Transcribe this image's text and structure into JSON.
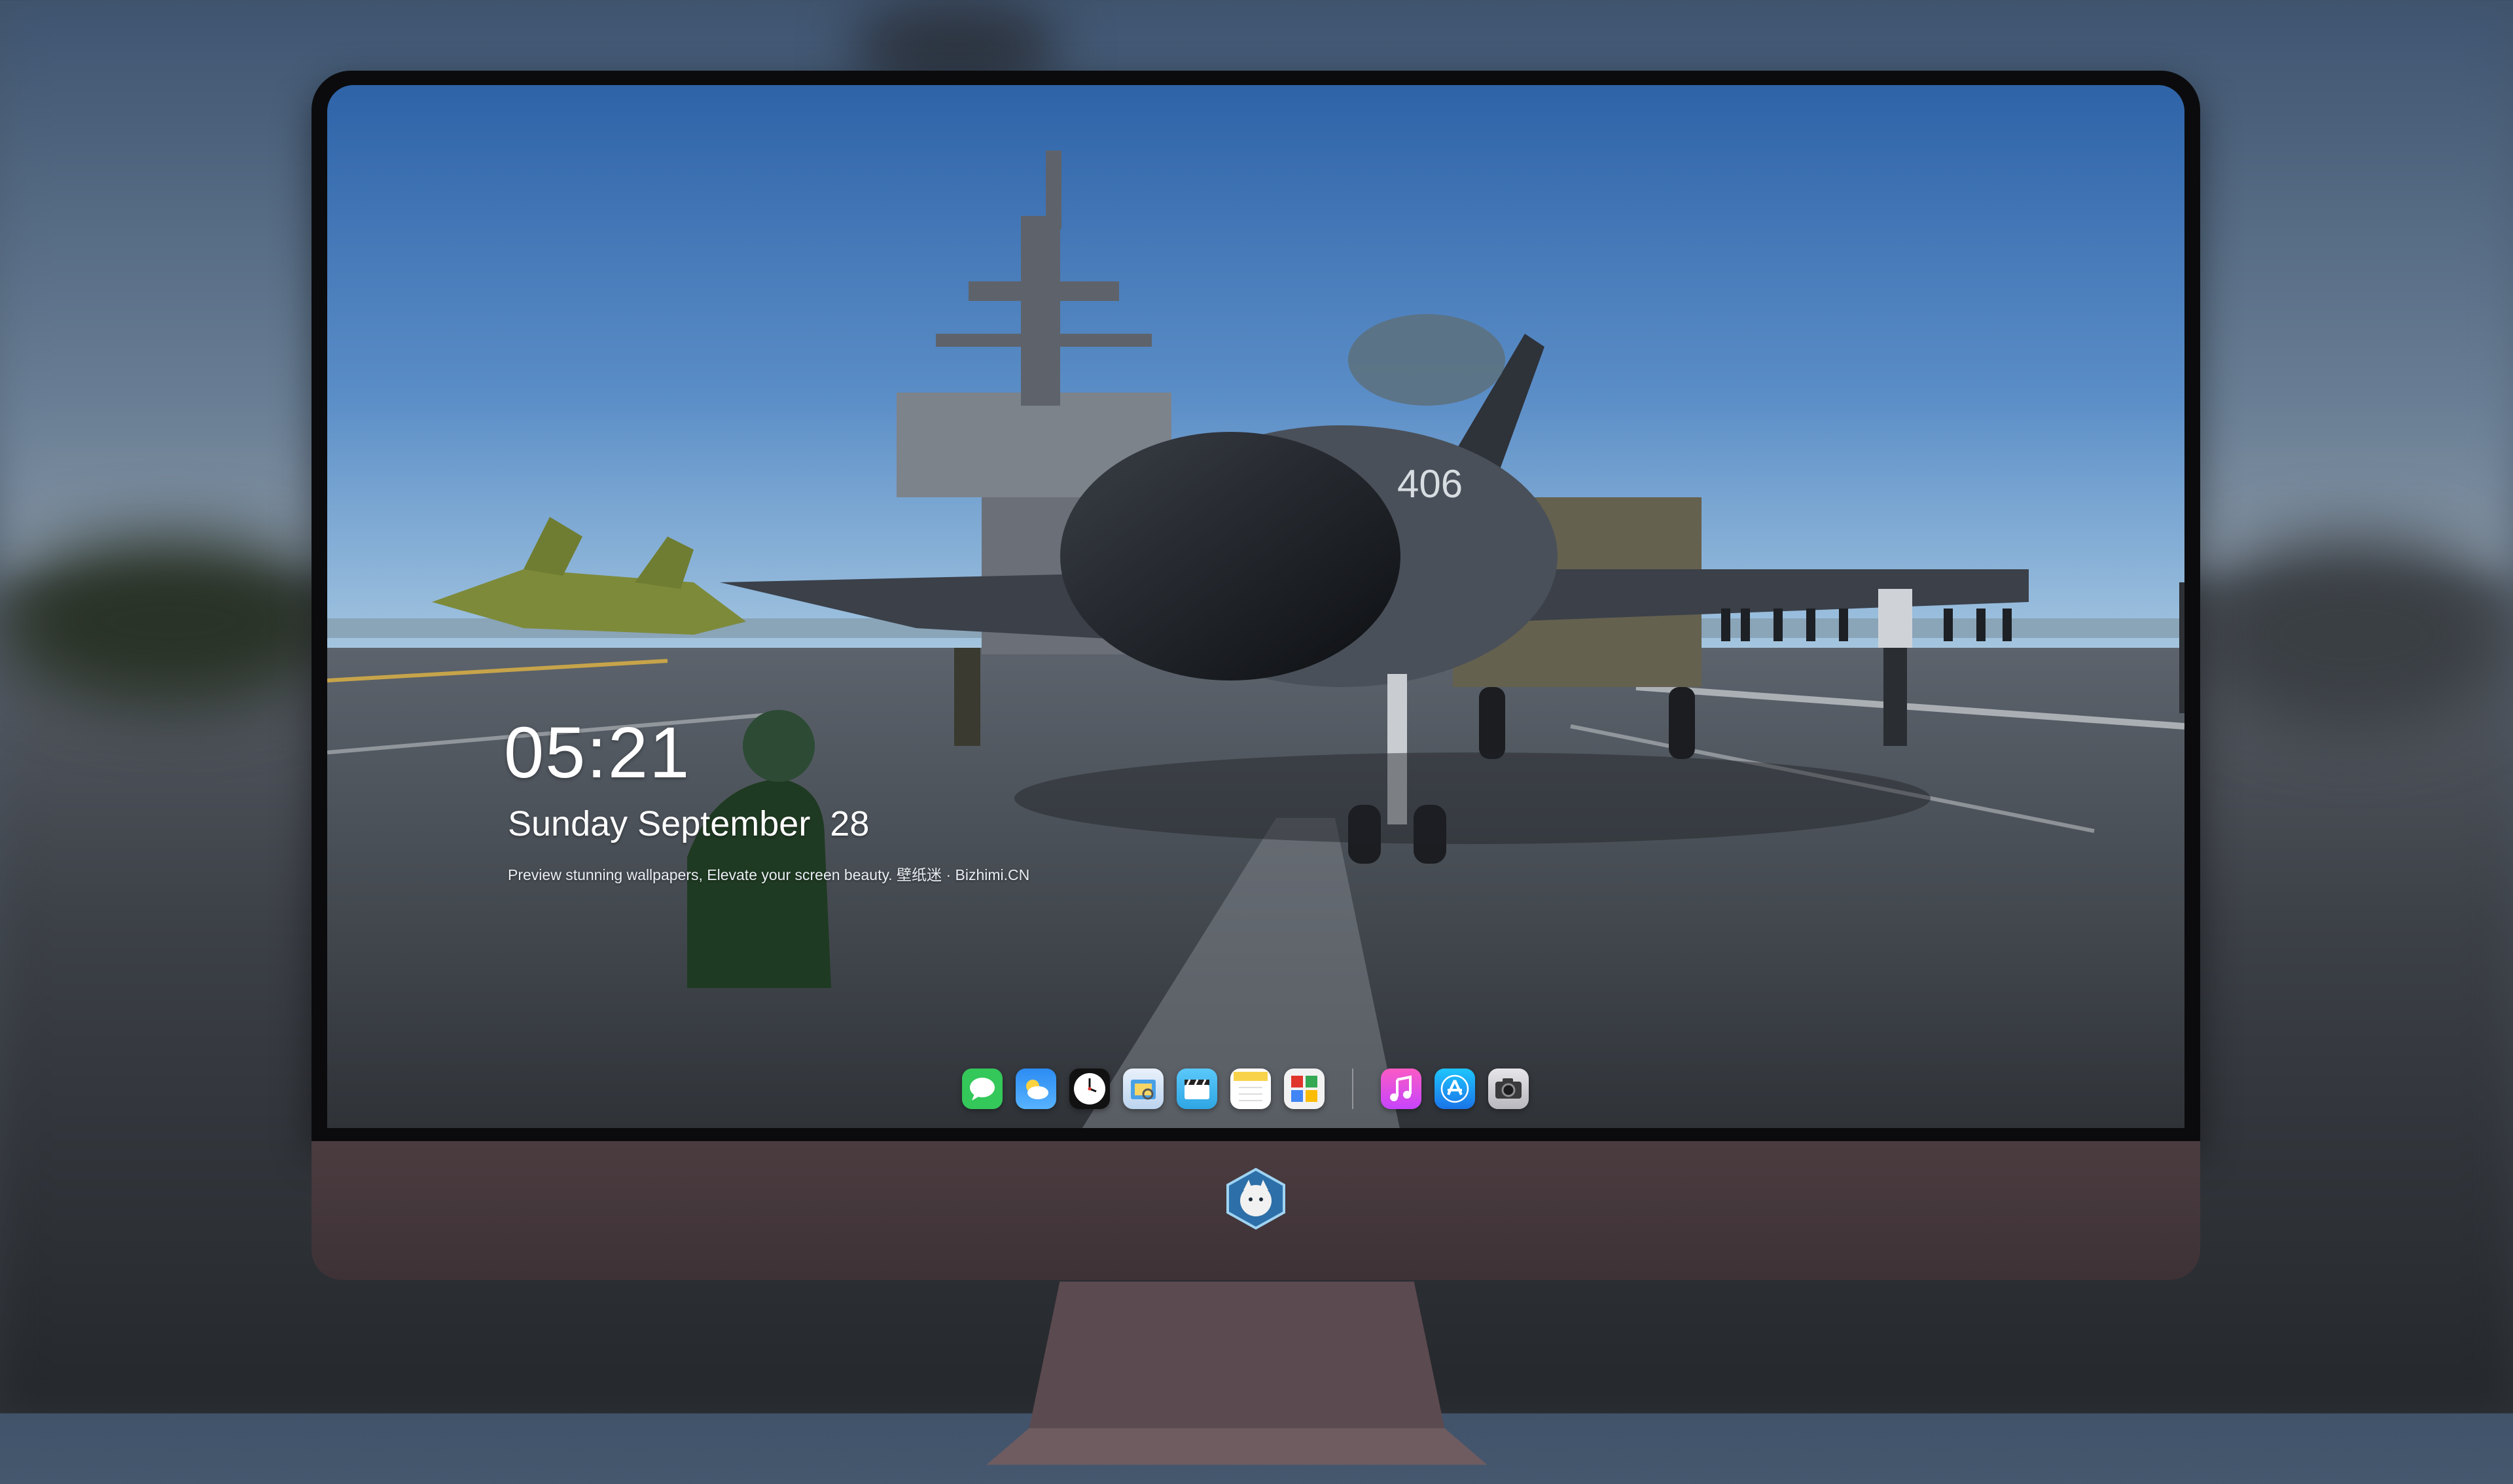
{
  "lock_screen": {
    "time": "05:21",
    "date": "Sunday September  28",
    "tagline": "Preview stunning wallpapers, Elevate your screen beauty. 壁纸迷 · Bizhimi.CN"
  },
  "jet": {
    "tail_number": "406"
  },
  "dock": {
    "apps": [
      {
        "name": "messages-icon"
      },
      {
        "name": "weather-icon"
      },
      {
        "name": "clock-icon"
      },
      {
        "name": "preview-icon"
      },
      {
        "name": "clips-icon"
      },
      {
        "name": "notes-icon"
      },
      {
        "name": "photo-booth-icon"
      },
      {
        "name": "itunes-icon"
      },
      {
        "name": "app-store-icon"
      },
      {
        "name": "camera-icon"
      }
    ]
  },
  "colors": {
    "chin": "#4b3c40",
    "bezel": "#0b0b0d",
    "sky_top": "#2e63a8",
    "deck": "#474d55",
    "text": "#ffffff"
  }
}
